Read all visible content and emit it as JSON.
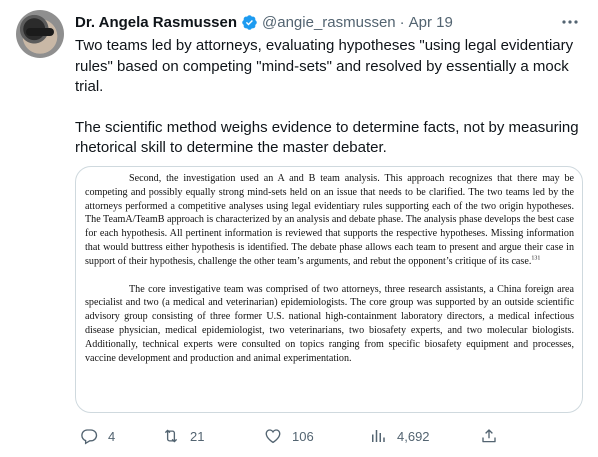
{
  "tweet": {
    "author_name": "Dr. Angela Rasmussen",
    "handle": "@angie_rasmussen",
    "separator": "·",
    "date": "Apr 19",
    "paragraphs": [
      "Two teams led by attorneys, evaluating hypotheses \"using legal evidentiary rules\" based on competing \"mind-sets\" and resolved by essentially a mock trial.",
      "The scientific method weighs evidence to determine facts, not by measuring rhetorical skill to determine the master debater."
    ],
    "image_text": {
      "paragraph1": "Second, the investigation used an A and B team analysis. This approach recognizes that there may be competing and possibly equally strong mind-sets held on an issue that needs to be clarified. The two teams led by the attorneys performed a competitive analyses using legal evidentiary rules supporting each of the two origin hypotheses. The TeamA/TeamB approach is characterized by an analysis and debate phase. The analysis phase develops the best case for each hypothesis. All pertinent information is reviewed that supports the respective hypotheses. Missing information that would buttress either hypothesis is identified. The debate phase allows each team to present and argue their case in support of their hypothesis, challenge the other team’s arguments, and rebut the opponent’s critique of its case.",
      "footnote": "131",
      "paragraph2": "The core investigative team was comprised of two attorneys, three research assistants, a China foreign area specialist and two (a medical and veterinarian) epidemiologists. The core group was supported by an outside scientific advisory group consisting of three former U.S. national high-containment laboratory directors, a medical infectious disease physician, medical epidemiologist, two veterinarians, two biosafety experts, and two molecular biologists.  Additionally, technical experts were consulted on topics ranging from specific biosafety equipment and processes, vaccine development and production and animal experimentation."
    },
    "actions": {
      "replies": "4",
      "retweets": "21",
      "likes": "106",
      "views": "4,692"
    },
    "colors": {
      "verified": "#1d9bf0",
      "muted": "#536471",
      "text": "#0f1419",
      "border": "#cfd9de"
    }
  }
}
